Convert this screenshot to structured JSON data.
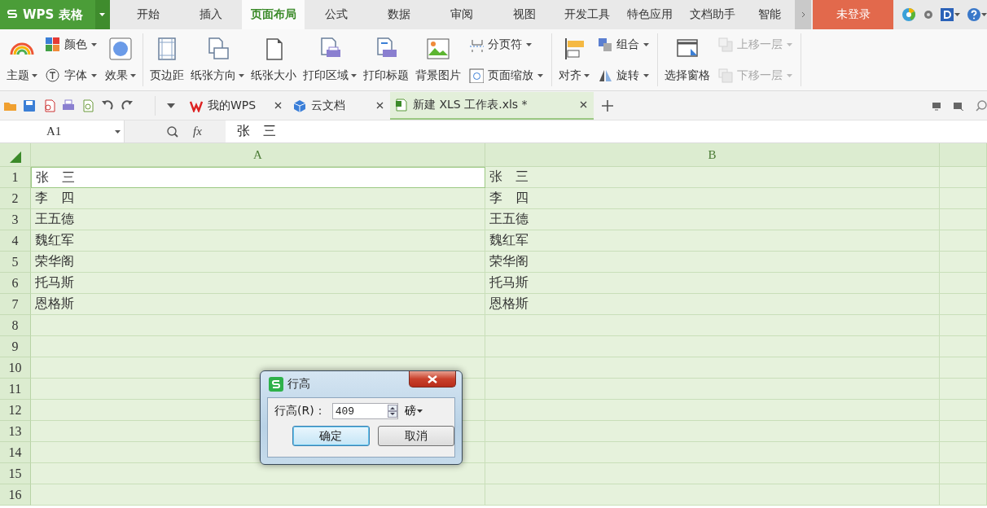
{
  "app_menu": {
    "label": "WPS 表格"
  },
  "menu_tabs": [
    {
      "label": "开始",
      "selected": false
    },
    {
      "label": "插入",
      "selected": false
    },
    {
      "label": "页面布局",
      "selected": true
    },
    {
      "label": "公式",
      "selected": false
    },
    {
      "label": "数据",
      "selected": false
    },
    {
      "label": "审阅",
      "selected": false
    },
    {
      "label": "视图",
      "selected": false
    },
    {
      "label": "开发工具",
      "selected": false
    },
    {
      "label": "特色应用",
      "selected": false
    },
    {
      "label": "文档助手",
      "selected": false
    },
    {
      "label": "智能",
      "selected": false
    }
  ],
  "login_button": "未登录",
  "ribbon": {
    "groups": [
      {
        "columns": [
          {
            "kind": "large",
            "label": "主题",
            "dropdown": true,
            "disabled": false
          },
          {
            "kind": "stack",
            "items": [
              {
                "label": "颜色",
                "dropdown": true,
                "disabled": false
              },
              {
                "label": "字体",
                "dropdown": true,
                "disabled": false
              }
            ]
          },
          {
            "kind": "large",
            "label": "效果",
            "dropdown": true,
            "disabled": false
          }
        ]
      },
      {
        "columns": [
          {
            "kind": "large",
            "label": "页边距",
            "dropdown": false,
            "disabled": false
          },
          {
            "kind": "large",
            "label": "纸张方向",
            "dropdown": true,
            "disabled": false
          },
          {
            "kind": "large",
            "label": "纸张大小",
            "dropdown": false,
            "disabled": false
          },
          {
            "kind": "large",
            "label": "打印区域",
            "dropdown": true,
            "disabled": false
          },
          {
            "kind": "large",
            "label": "打印标题",
            "dropdown": false,
            "disabled": false
          },
          {
            "kind": "large",
            "label": "背景图片",
            "dropdown": false,
            "disabled": false
          },
          {
            "kind": "stack",
            "items": [
              {
                "label": "分页符",
                "dropdown": true,
                "disabled": false
              },
              {
                "label": "页面缩放",
                "dropdown": true,
                "disabled": false
              }
            ]
          }
        ]
      },
      {
        "columns": [
          {
            "kind": "large",
            "label": "对齐",
            "dropdown": true,
            "disabled": false
          },
          {
            "kind": "stack",
            "items": [
              {
                "label": "组合",
                "dropdown": true,
                "disabled": false
              },
              {
                "label": "旋转",
                "dropdown": true,
                "disabled": false
              }
            ]
          }
        ]
      },
      {
        "columns": [
          {
            "kind": "large",
            "label": "选择窗格",
            "dropdown": false,
            "disabled": false
          },
          {
            "kind": "stack",
            "items": [
              {
                "label": "上移一层",
                "dropdown": true,
                "disabled": true
              },
              {
                "label": "下移一层",
                "dropdown": true,
                "disabled": true
              }
            ]
          }
        ]
      }
    ]
  },
  "doc_tabs": [
    {
      "label": "我的WPS",
      "selected": false
    },
    {
      "label": "云文档",
      "selected": false
    },
    {
      "label": "新建 XLS 工作表.xls *",
      "selected": true
    }
  ],
  "formula_bar": {
    "name_box": "A1",
    "function_button": "fx",
    "formula": "张　三"
  },
  "sheet": {
    "columns": [
      "A",
      "B"
    ],
    "rows": [
      {
        "number": "1",
        "cells": [
          {
            "text": "张　三",
            "selected": true
          },
          {
            "text": "张　三",
            "selected": false
          }
        ]
      },
      {
        "number": "2",
        "cells": [
          {
            "text": "李　四",
            "selected": false
          },
          {
            "text": "李　四",
            "selected": false
          }
        ]
      },
      {
        "number": "3",
        "cells": [
          {
            "text": "王五德",
            "selected": false
          },
          {
            "text": "王五德",
            "selected": false
          }
        ]
      },
      {
        "number": "4",
        "cells": [
          {
            "text": "魏红军",
            "selected": false
          },
          {
            "text": "魏红军",
            "selected": false
          }
        ]
      },
      {
        "number": "5",
        "cells": [
          {
            "text": "荣华阁",
            "selected": false
          },
          {
            "text": "荣华阁",
            "selected": false
          }
        ]
      },
      {
        "number": "6",
        "cells": [
          {
            "text": "托马斯",
            "selected": false
          },
          {
            "text": "托马斯",
            "selected": false
          }
        ]
      },
      {
        "number": "7",
        "cells": [
          {
            "text": "恩格斯",
            "selected": false
          },
          {
            "text": "恩格斯",
            "selected": false
          }
        ]
      },
      {
        "number": "8",
        "cells": []
      },
      {
        "number": "9",
        "cells": []
      },
      {
        "number": "10",
        "cells": []
      },
      {
        "number": "11",
        "cells": []
      },
      {
        "number": "12",
        "cells": []
      },
      {
        "number": "13",
        "cells": []
      },
      {
        "number": "14",
        "cells": []
      },
      {
        "number": "15",
        "cells": []
      },
      {
        "number": "16",
        "cells": []
      }
    ]
  },
  "dialog": {
    "title": "行高",
    "field_label": "行高(R)：",
    "value": "409",
    "unit": "磅",
    "buttons": [
      {
        "label": "确定",
        "default": true
      },
      {
        "label": "取消",
        "default": false
      }
    ]
  }
}
